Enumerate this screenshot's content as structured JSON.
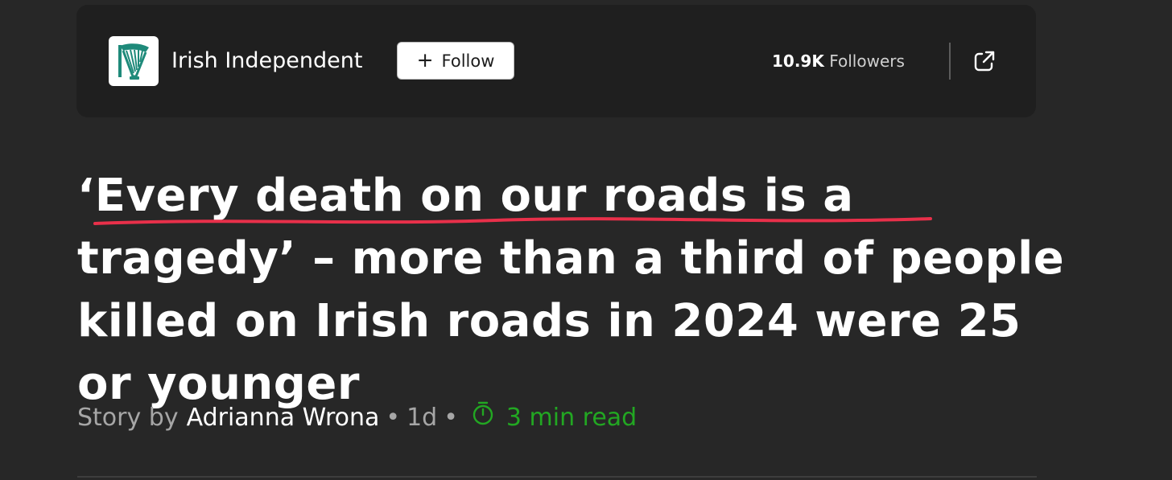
{
  "publisher": {
    "name": "Irish Independent",
    "logo_icon": "harp-icon",
    "logo_color": "#1e8a7a",
    "follow_label": "Follow",
    "follow_icon": "plus-icon",
    "followers_count": "10.9K",
    "followers_label": "Followers",
    "open_icon": "external-link-icon"
  },
  "article": {
    "headline": "‘Every death on our roads is a tragedy’ – more than a third of people killed on Irish roads in 2024 were 25 or younger",
    "underline_color": "#e8304a",
    "byline_prefix": "Story by",
    "author": "Adrianna Wrona",
    "age": "1d",
    "separator": "•",
    "read_time": "3 min read",
    "read_time_icon": "timer-icon",
    "read_time_color": "#22a722"
  }
}
